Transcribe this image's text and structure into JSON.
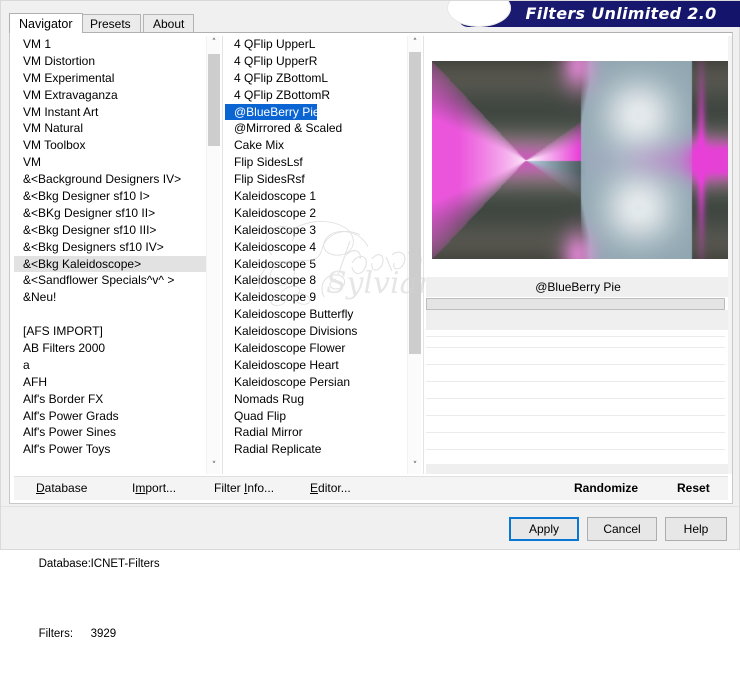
{
  "window": {
    "banner_title": "Filters Unlimited 2.0",
    "banner_color": "#191970"
  },
  "tabs": [
    {
      "label": "Navigator",
      "active": true
    },
    {
      "label": "Presets",
      "active": false
    },
    {
      "label": "About",
      "active": false
    }
  ],
  "categories": {
    "selected": "&<Bkg Kaleidoscope>",
    "items": [
      "VM 1",
      "VM Distortion",
      "VM Experimental",
      "VM Extravaganza",
      "VM Instant Art",
      "VM Natural",
      "VM Toolbox",
      "VM",
      "&<Background Designers IV>",
      "&<Bkg Designer sf10 I>",
      "&<BKg Designer sf10 II>",
      "&<Bkg Designer sf10 III>",
      "&<Bkg Designers sf10 IV>",
      "&<Bkg Kaleidoscope>",
      "&<Sandflower Specials^v^ >",
      "&Neu!",
      "",
      "[AFS IMPORT]",
      "AB Filters 2000",
      "a",
      "AFH",
      "Alf's Border FX",
      "Alf's Power Grads",
      "Alf's Power Sines",
      "Alf's Power Toys"
    ]
  },
  "filters": {
    "selected": "@BlueBerry Pie",
    "items": [
      "4 QFlip UpperL",
      "4 QFlip UpperR",
      "4 QFlip ZBottomL",
      "4 QFlip ZBottomR",
      "@BlueBerry Pie",
      "@Mirrored & Scaled",
      "Cake Mix",
      "Flip SidesLsf",
      "Flip SidesRsf",
      "Kaleidoscope 1",
      "Kaleidoscope 2",
      "Kaleidoscope 3",
      "Kaleidoscope 4",
      "Kaleidoscope 5",
      "Kaleidoscope 8",
      "Kaleidoscope 9",
      "Kaleidoscope Butterfly",
      "Kaleidoscope Divisions",
      "Kaleidoscope Flower",
      "Kaleidoscope Heart",
      "Kaleidoscope Persian",
      "Nomads Rug",
      "Quad Flip",
      "Radial Mirror",
      "Radial Replicate"
    ]
  },
  "preview": {
    "filter_name": "@BlueBerry Pie",
    "colors": {
      "magenta": "#e83fd8",
      "pink": "#f7b9ea",
      "gray_green": "#4a524b",
      "light_blue": "#b8d4e6",
      "white": "#ffffff",
      "taupe": "#a39a90"
    }
  },
  "watermark": {
    "text": "Sylviane"
  },
  "commands": {
    "database": {
      "prefix": "",
      "accel": "D",
      "rest": "atabase"
    },
    "import": {
      "prefix": "I",
      "accel": "m",
      "rest": "port..."
    },
    "filter_info": {
      "prefix": "Filter ",
      "accel": "I",
      "rest": "nfo..."
    },
    "editor": {
      "prefix": "",
      "accel": "E",
      "rest": "ditor..."
    },
    "randomize": "Randomize",
    "reset": "Reset"
  },
  "status": {
    "database_label": "Database:",
    "database_value": "ICNET-Filters",
    "filters_label": "Filters:",
    "filters_value": "3929"
  },
  "dialog_buttons": {
    "apply": "Apply",
    "cancel": "Cancel",
    "help": "Help",
    "focus_color": "#0a78d2"
  },
  "scroll": {
    "up_glyph": "˄",
    "down_glyph": "˅"
  }
}
